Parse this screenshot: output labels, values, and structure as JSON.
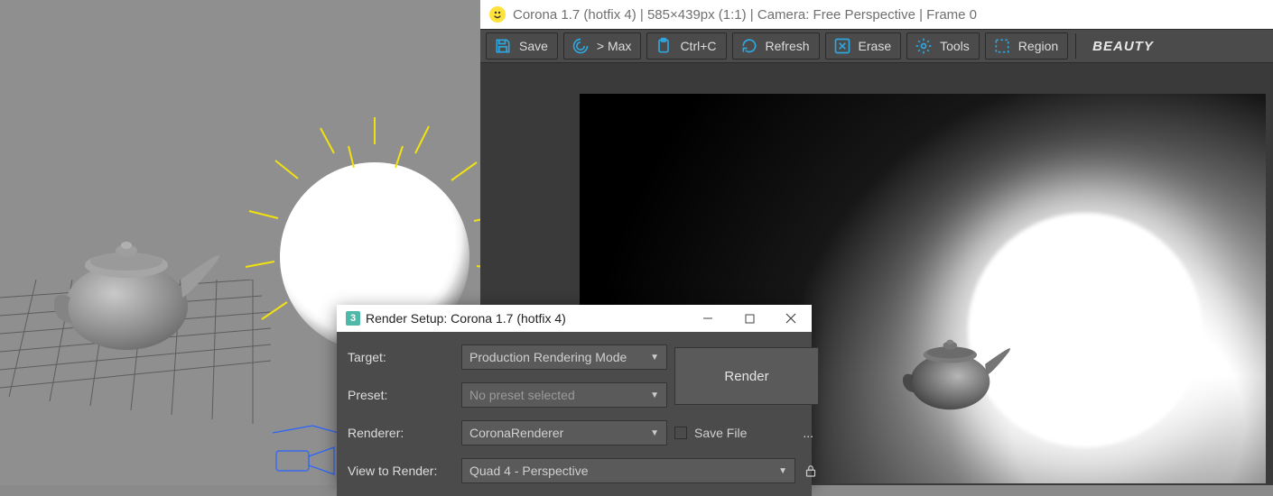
{
  "titlebar": {
    "text": "Corona 1.7 (hotfix 4) | 585×439px (1:1) | Camera: Free Perspective | Frame 0"
  },
  "toolbar": {
    "save": "Save",
    "max": "> Max",
    "copy": "Ctrl+C",
    "refresh": "Refresh",
    "erase": "Erase",
    "tools": "Tools",
    "region": "Region",
    "pass": "BEAUTY"
  },
  "dialog": {
    "title": "Render Setup: Corona 1.7 (hotfix 4)",
    "labels": {
      "target": "Target:",
      "preset": "Preset:",
      "renderer": "Renderer:",
      "view": "View to Render:",
      "savefile": "Save File",
      "dots": "..."
    },
    "values": {
      "target": "Production Rendering Mode",
      "preset": "No preset selected",
      "renderer": "CoronaRenderer",
      "view": "Quad 4 - Perspective"
    },
    "render_btn": "Render",
    "appicon": "3"
  }
}
